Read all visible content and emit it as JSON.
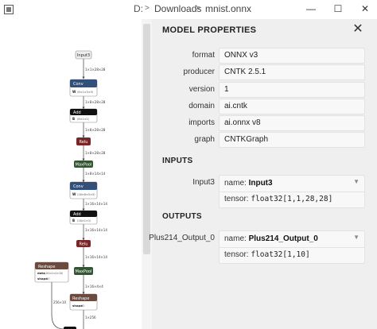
{
  "titlebar": {
    "path_cut": "D:",
    "separator": ">",
    "folder": "Downloads",
    "file": "mnist.onnx",
    "minimize_glyph": "—",
    "maximize_glyph": "☐",
    "close_glyph": "✕"
  },
  "graph": {
    "nodes": {
      "input3": "Input3",
      "conv1": "Conv",
      "conv1_w": "W",
      "conv1_w_shape": "⟨8×1×5×5⟩",
      "add1": "Add",
      "add1_b": "B",
      "add1_b_shape": "⟨8×1×1⟩",
      "relu1": "Relu",
      "pool1": "MaxPool",
      "conv2": "Conv",
      "conv2_w": "W",
      "conv2_w_shape": "⟨16×8×5×5⟩",
      "add2": "Add",
      "add2_b": "B",
      "add2_b_shape": "⟨16×1×1⟩",
      "relu2": "Relu",
      "pool2": "MaxPool",
      "reshape1": "Reshape",
      "reshape1_data": "data",
      "reshape1_data_shape": "⟨16×4×4×10⟩",
      "reshape1_shape": "shape",
      "reshape1_shape_val": "⟨2⟩",
      "reshape2": "Reshape",
      "reshape2_shape": "shape",
      "reshape2_shape_val": "⟨2⟩"
    },
    "edges": {
      "e1": "1×1×28×28",
      "e2": "1×8×28×28",
      "e3": "1×8×28×28",
      "e4": "1×8×28×28",
      "e5": "1×8×14×14",
      "e6": "1×16×14×14",
      "e7": "1×16×14×14",
      "e8": "1×16×14×14",
      "e9": "1×16×4×4",
      "e10": "256×10",
      "e11": "1×256"
    },
    "toolbar": {
      "list_glyph": "☰",
      "zoom_in_glyph": "+",
      "zoom_out_glyph": "−"
    }
  },
  "panel": {
    "title": "MODEL PROPERTIES",
    "close_glyph": "✕",
    "properties": [
      {
        "label": "format",
        "value": "ONNX v3"
      },
      {
        "label": "producer",
        "value": "CNTK 2.5.1"
      },
      {
        "label": "version",
        "value": "1"
      },
      {
        "label": "domain",
        "value": "ai.cntk"
      },
      {
        "label": "imports",
        "value": "ai.onnx v8"
      },
      {
        "label": "graph",
        "value": "CNTKGraph"
      }
    ],
    "inputs_heading": "INPUTS",
    "outputs_heading": "OUTPUTS",
    "inputs": [
      {
        "label": "Input3",
        "name_prefix": "name:",
        "name": "Input3",
        "tensor_prefix": "tensor:",
        "tensor_type": "float32[1,1,28,28]",
        "expand_glyph": "▼"
      }
    ],
    "outputs": [
      {
        "label": "Plus214_Output_0",
        "name_prefix": "name:",
        "name": "Plus214_Output_0",
        "tensor_prefix": "tensor:",
        "tensor_type": "float32[1,10]",
        "expand_glyph": "▼"
      }
    ]
  },
  "colors": {
    "conv": "#33507a",
    "add": "#111111",
    "relu": "#7a2626",
    "pool": "#335533",
    "reshape": "#6b4a40",
    "panel_bg": "#efefef"
  }
}
